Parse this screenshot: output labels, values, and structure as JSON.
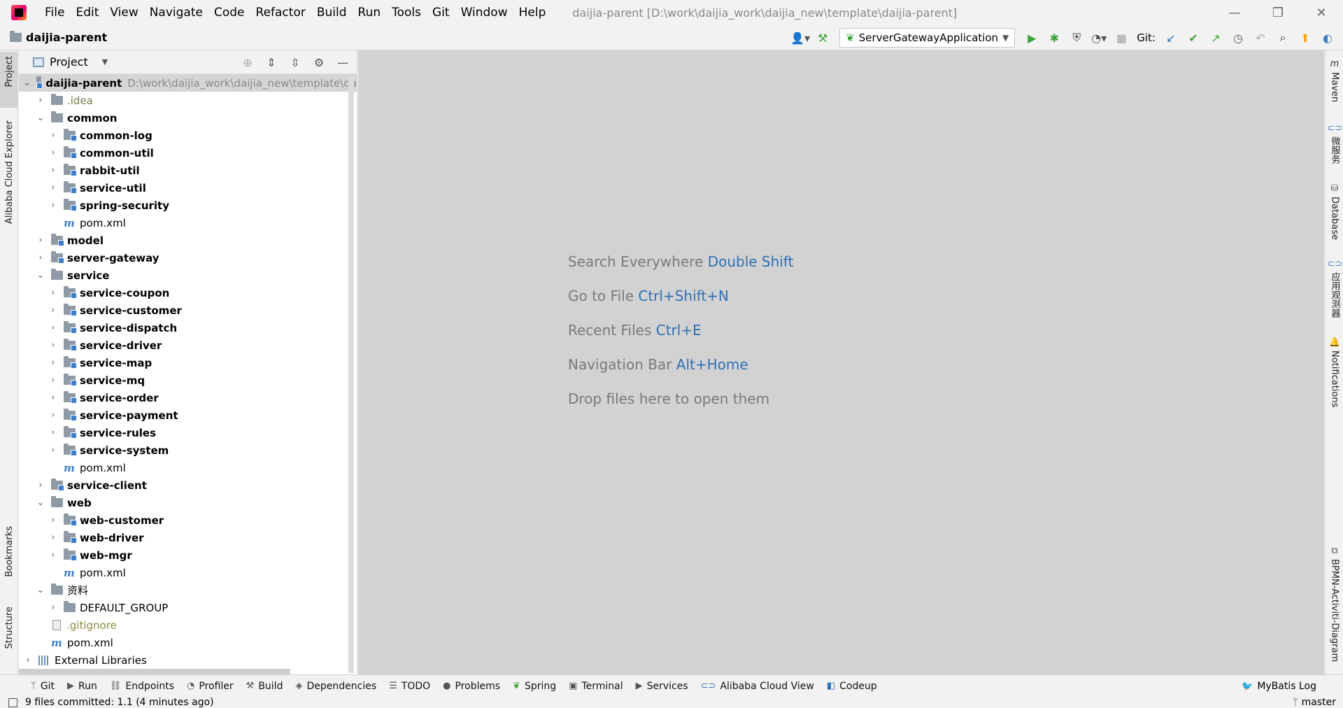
{
  "menu": [
    "File",
    "Edit",
    "View",
    "Navigate",
    "Code",
    "Refactor",
    "Build",
    "Run",
    "Tools",
    "Git",
    "Window",
    "Help"
  ],
  "window_title": "daijia-parent [D:\\work\\daijia_work\\daijia_new\\template\\daijia-parent]",
  "navbar": {
    "crumb": "daijia-parent",
    "run_config": "ServerGatewayApplication",
    "git_label": "Git:"
  },
  "left_tabs": {
    "project": "Project",
    "cloud": "Alibaba Cloud Explorer",
    "bookmarks": "Bookmarks",
    "structure": "Structure"
  },
  "right_tabs": {
    "maven": "Maven",
    "microservice": "微服务",
    "database": "Database",
    "app_monitor": "应用观测器",
    "notifications": "Notifications",
    "bpmn": "BPMN-Activiti-Diagram"
  },
  "project_panel": {
    "title": "Project",
    "root": {
      "name": "daijia-parent",
      "path": "D:\\work\\daijia_work\\daijia_new\\template\\da"
    },
    "tree": [
      {
        "name": ".idea",
        "kind": "folder",
        "style": "muted",
        "level": 1,
        "arrow": "collapsed"
      },
      {
        "name": "common",
        "kind": "folder",
        "style": "bold",
        "level": 1,
        "arrow": "expanded"
      },
      {
        "name": "common-log",
        "kind": "module",
        "style": "bold",
        "level": 2,
        "arrow": "collapsed"
      },
      {
        "name": "common-util",
        "kind": "module",
        "style": "bold",
        "level": 2,
        "arrow": "collapsed"
      },
      {
        "name": "rabbit-util",
        "kind": "module",
        "style": "bold",
        "level": 2,
        "arrow": "collapsed"
      },
      {
        "name": "service-util",
        "kind": "module",
        "style": "bold",
        "level": 2,
        "arrow": "collapsed"
      },
      {
        "name": "spring-security",
        "kind": "module",
        "style": "bold",
        "level": 2,
        "arrow": "collapsed"
      },
      {
        "name": "pom.xml",
        "kind": "maven",
        "style": "normal",
        "level": 2,
        "arrow": "none"
      },
      {
        "name": "model",
        "kind": "module",
        "style": "bold",
        "level": 1,
        "arrow": "collapsed"
      },
      {
        "name": "server-gateway",
        "kind": "module",
        "style": "bold",
        "level": 1,
        "arrow": "collapsed"
      },
      {
        "name": "service",
        "kind": "folder",
        "style": "bold",
        "level": 1,
        "arrow": "expanded"
      },
      {
        "name": "service-coupon",
        "kind": "module",
        "style": "bold",
        "level": 2,
        "arrow": "collapsed"
      },
      {
        "name": "service-customer",
        "kind": "module",
        "style": "bold",
        "level": 2,
        "arrow": "collapsed"
      },
      {
        "name": "service-dispatch",
        "kind": "module",
        "style": "bold",
        "level": 2,
        "arrow": "collapsed"
      },
      {
        "name": "service-driver",
        "kind": "module",
        "style": "bold",
        "level": 2,
        "arrow": "collapsed"
      },
      {
        "name": "service-map",
        "kind": "module",
        "style": "bold",
        "level": 2,
        "arrow": "collapsed"
      },
      {
        "name": "service-mq",
        "kind": "module",
        "style": "bold",
        "level": 2,
        "arrow": "collapsed"
      },
      {
        "name": "service-order",
        "kind": "module",
        "style": "bold",
        "level": 2,
        "arrow": "collapsed"
      },
      {
        "name": "service-payment",
        "kind": "module",
        "style": "bold",
        "level": 2,
        "arrow": "collapsed"
      },
      {
        "name": "service-rules",
        "kind": "module",
        "style": "bold",
        "level": 2,
        "arrow": "collapsed"
      },
      {
        "name": "service-system",
        "kind": "module",
        "style": "bold",
        "level": 2,
        "arrow": "collapsed"
      },
      {
        "name": "pom.xml",
        "kind": "maven",
        "style": "normal",
        "level": 2,
        "arrow": "none"
      },
      {
        "name": "service-client",
        "kind": "module",
        "style": "bold",
        "level": 1,
        "arrow": "collapsed"
      },
      {
        "name": "web",
        "kind": "folder",
        "style": "bold",
        "level": 1,
        "arrow": "expanded"
      },
      {
        "name": "web-customer",
        "kind": "module",
        "style": "bold",
        "level": 2,
        "arrow": "collapsed"
      },
      {
        "name": "web-driver",
        "kind": "module",
        "style": "bold",
        "level": 2,
        "arrow": "collapsed"
      },
      {
        "name": "web-mgr",
        "kind": "module",
        "style": "bold",
        "level": 2,
        "arrow": "collapsed"
      },
      {
        "name": "pom.xml",
        "kind": "maven",
        "style": "normal",
        "level": 2,
        "arrow": "none"
      },
      {
        "name": "资料",
        "kind": "folder",
        "style": "normal",
        "level": 1,
        "arrow": "expanded"
      },
      {
        "name": "DEFAULT_GROUP",
        "kind": "folder",
        "style": "normal",
        "level": 2,
        "arrow": "collapsed"
      },
      {
        "name": ".gitignore",
        "kind": "gitignore",
        "style": "git",
        "level": 1,
        "arrow": "none"
      },
      {
        "name": "pom.xml",
        "kind": "maven",
        "style": "normal",
        "level": 1,
        "arrow": "none"
      },
      {
        "name": "External Libraries",
        "kind": "library",
        "style": "normal",
        "level": 0,
        "arrow": "collapsed"
      }
    ]
  },
  "editor_hints": [
    {
      "text": "Search Everywhere",
      "key": "Double Shift"
    },
    {
      "text": "Go to File",
      "key": "Ctrl+Shift+N"
    },
    {
      "text": "Recent Files",
      "key": "Ctrl+E"
    },
    {
      "text": "Navigation Bar",
      "key": "Alt+Home"
    },
    {
      "text": "Drop files here to open them",
      "key": ""
    }
  ],
  "tool_windows": [
    {
      "label": "Git",
      "icon": "git-branch-icon",
      "glyph": "ᛘ"
    },
    {
      "label": "Run",
      "icon": "run-icon",
      "glyph": "▶"
    },
    {
      "label": "Endpoints",
      "icon": "endpoints-icon",
      "glyph": "⛓"
    },
    {
      "label": "Profiler",
      "icon": "profiler-icon",
      "glyph": "◔"
    },
    {
      "label": "Build",
      "icon": "hammer-icon",
      "glyph": "⚒"
    },
    {
      "label": "Dependencies",
      "icon": "dependencies-icon",
      "glyph": "◈"
    },
    {
      "label": "TODO",
      "icon": "list-icon",
      "glyph": "☰"
    },
    {
      "label": "Problems",
      "icon": "problems-icon",
      "glyph": "●"
    },
    {
      "label": "Spring",
      "icon": "spring-icon",
      "glyph": "❦"
    },
    {
      "label": "Terminal",
      "icon": "terminal-icon",
      "glyph": "▣"
    },
    {
      "label": "Services",
      "icon": "services-icon",
      "glyph": "▶"
    },
    {
      "label": "Alibaba Cloud View",
      "icon": "alibaba-cloud-icon",
      "glyph": "⊂⊃"
    },
    {
      "label": "Codeup",
      "icon": "codeup-icon",
      "glyph": "◧"
    }
  ],
  "tool_right": {
    "label": "MyBatis Log"
  },
  "status": {
    "message": "9 files committed: 1.1 (4 minutes ago)",
    "branch": "master"
  },
  "colors": {
    "accent": "#2f6fb5",
    "editor_bg": "#d2d2d2",
    "run_green": "#3fa33f"
  }
}
